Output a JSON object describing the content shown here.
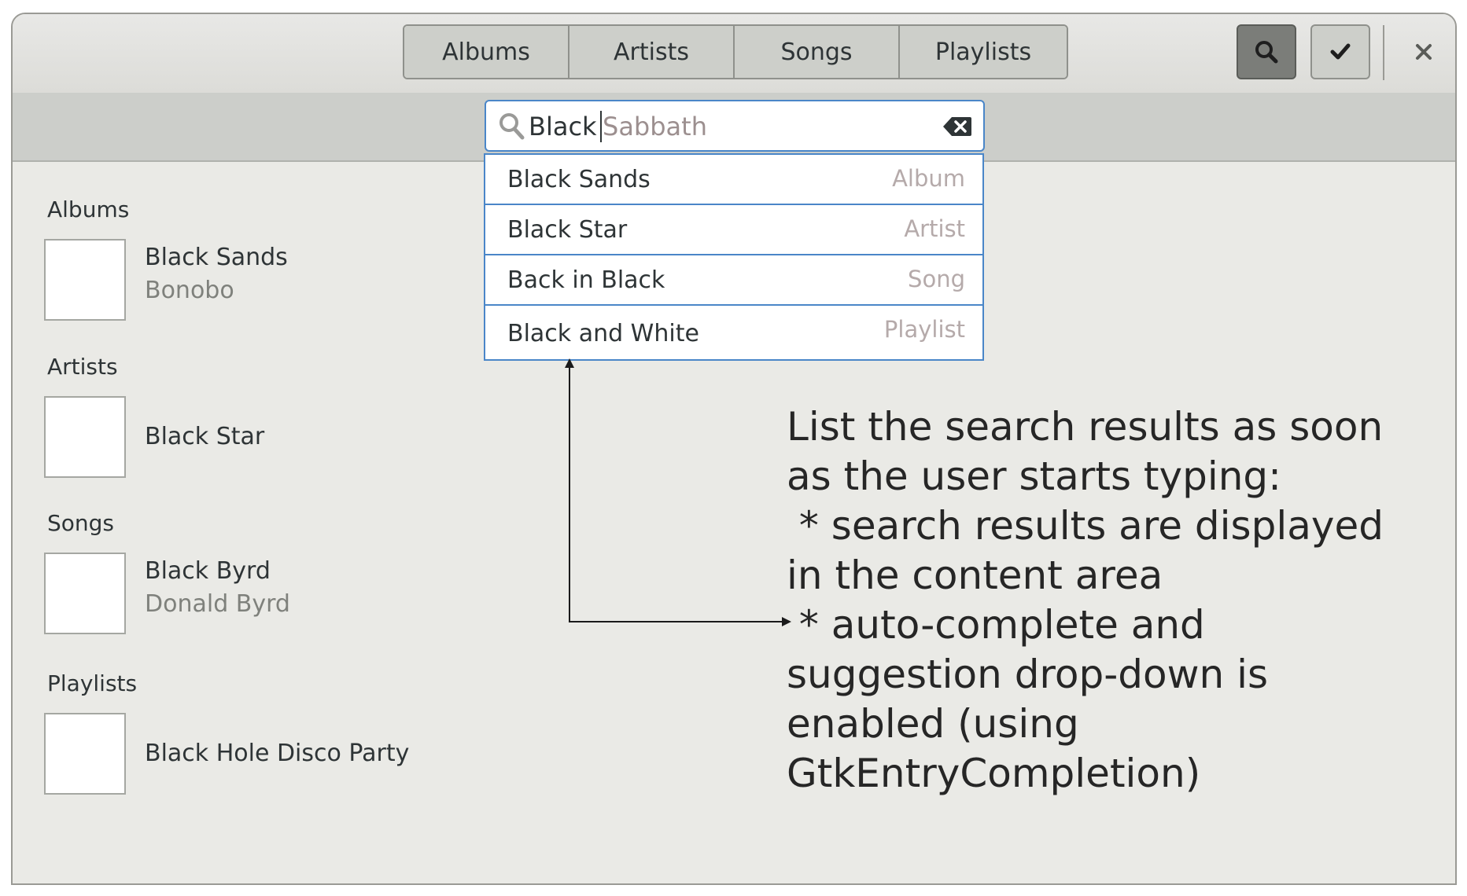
{
  "headerbar": {
    "tabs": [
      {
        "label": "Albums"
      },
      {
        "label": "Artists"
      },
      {
        "label": "Songs"
      },
      {
        "label": "Playlists"
      }
    ],
    "search_button_icon": "search-icon",
    "select_button_icon": "checkmark-icon",
    "close_button_icon": "close-icon"
  },
  "search": {
    "typed_text": "Black ",
    "inline_completion": "Sabbath",
    "clear_icon": "backspace-clear-icon"
  },
  "suggestions": [
    {
      "label": "Black Sands",
      "kind": "Album"
    },
    {
      "label": "Black Star",
      "kind": "Artist"
    },
    {
      "label": "Back in Black",
      "kind": "Song"
    },
    {
      "label": "Black and White",
      "kind": "Playlist"
    }
  ],
  "results": {
    "albums": {
      "title": "Albums",
      "items": [
        {
          "title": "Black Sands",
          "subtitle": "Bonobo"
        }
      ]
    },
    "artists": {
      "title": "Artists",
      "items": [
        {
          "title": "Black Star"
        }
      ]
    },
    "songs": {
      "title": "Songs",
      "items": [
        {
          "title": "Black Byrd",
          "subtitle": "Donald Byrd"
        }
      ]
    },
    "playlists": {
      "title": "Playlists",
      "items": [
        {
          "title": "Black Hole Disco Party"
        }
      ]
    }
  },
  "annotation": {
    "lines": [
      "List the search results as soon",
      "as the user starts typing:",
      " * search results are displayed",
      "in the content area",
      " * auto-complete and",
      "suggestion drop-down is",
      "enabled (using",
      "GtkEntryCompletion)"
    ]
  },
  "colors": {
    "accent_border": "#4a86c8",
    "active_button": "#7b7d79",
    "background": "#eaeae6"
  }
}
